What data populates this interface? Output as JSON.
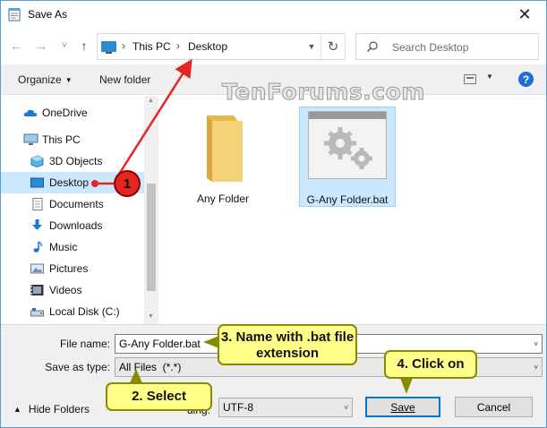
{
  "window": {
    "title": "Save As",
    "close_glyph": "✕"
  },
  "nav": {
    "back_glyph": "←",
    "forward_glyph": "→",
    "recent_glyph": "˅",
    "up_glyph": "↑",
    "breadcrumbs": [
      "This PC",
      "Desktop"
    ],
    "chevron": "›",
    "refresh_glyph": "↻",
    "search_placeholder": "Search Desktop"
  },
  "toolbar": {
    "organize": "Organize",
    "new_folder": "New folder",
    "help": "?"
  },
  "sidebar": {
    "items": [
      {
        "label": "OneDrive",
        "icon": "cloud-icon"
      },
      {
        "label": "This PC",
        "icon": "computer-icon"
      },
      {
        "label": "3D Objects",
        "icon": "cube-icon"
      },
      {
        "label": "Desktop",
        "icon": "desktop-icon",
        "selected": true
      },
      {
        "label": "Documents",
        "icon": "document-icon"
      },
      {
        "label": "Downloads",
        "icon": "download-icon"
      },
      {
        "label": "Music",
        "icon": "music-icon"
      },
      {
        "label": "Pictures",
        "icon": "picture-icon"
      },
      {
        "label": "Videos",
        "icon": "video-icon"
      },
      {
        "label": "Local Disk (C:)",
        "icon": "drive-icon"
      }
    ]
  },
  "files": [
    {
      "name": "Any Folder",
      "icon": "folder-icon"
    },
    {
      "name": "G-Any Folder.bat",
      "icon": "batch-file-icon",
      "selected": true
    }
  ],
  "form": {
    "file_name_label": "File name:",
    "file_name_value": "G-Any Folder.bat",
    "save_type_label": "Save as type:",
    "save_type_value": "All Files  (*.*)",
    "encoding_label": "ding:",
    "encoding_value": "UTF-8"
  },
  "footer": {
    "hide_folders": "Hide Folders",
    "save": "Save",
    "cancel": "Cancel"
  },
  "annotations": {
    "badge_1": "1",
    "callout_name": "3. Name with .bat file extension",
    "callout_select": "2. Select",
    "callout_click": "4. Click on"
  },
  "watermark": "TenForums.com",
  "colors": {
    "accent": "#0078d7",
    "selection": "#cce8ff",
    "callout": "#ffff8a",
    "arrow": "#e52521"
  }
}
